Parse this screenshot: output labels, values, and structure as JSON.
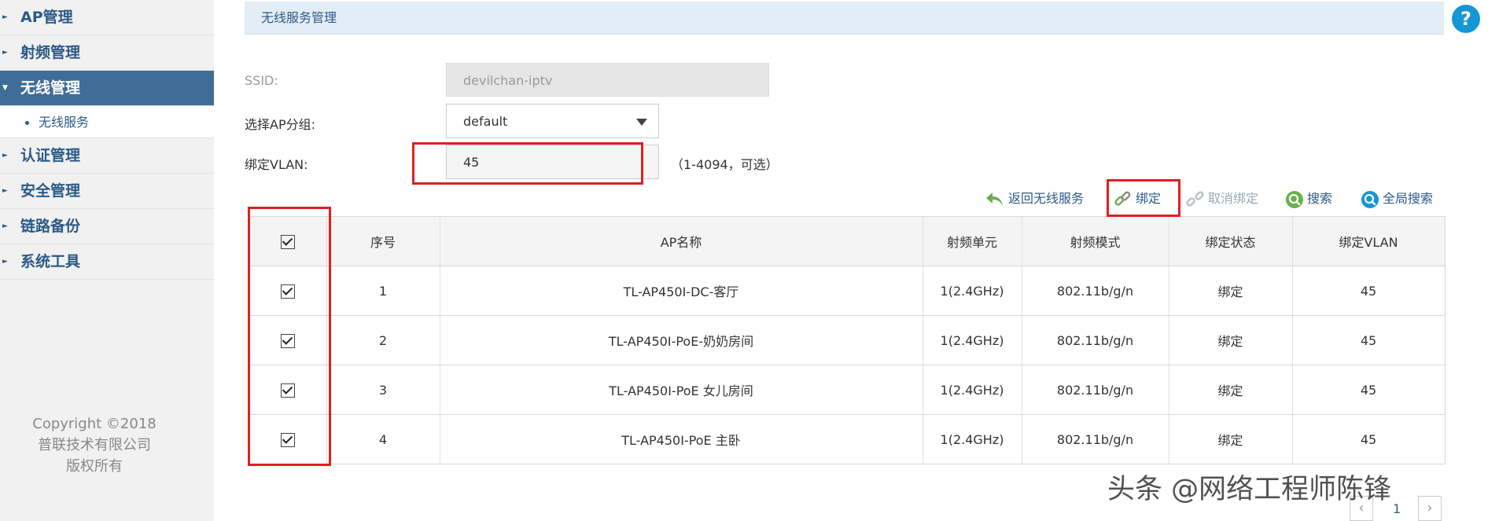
{
  "sidebar": {
    "items": [
      {
        "label": "AP管理"
      },
      {
        "label": "射频管理"
      },
      {
        "label": "无线管理",
        "sub": "无线服务"
      },
      {
        "label": "认证管理"
      },
      {
        "label": "安全管理"
      },
      {
        "label": "链路备份"
      },
      {
        "label": "系统工具"
      }
    ],
    "copyright": [
      "Copyright ©2018",
      "普联技术有限公司",
      "版权所有"
    ]
  },
  "header": {
    "title": "无线服务管理",
    "help": "?"
  },
  "form": {
    "ssid_label": "SSID:",
    "ssid_value": "devilchan-iptv",
    "group_label": "选择AP分组:",
    "group_value": "default",
    "vlan_label": "绑定VLAN:",
    "vlan_value": "45",
    "vlan_hint": "（1-4094，可选）"
  },
  "toolbar": {
    "back": "返回无线服务",
    "bind": "绑定",
    "unbind": "取消绑定",
    "search": "搜索",
    "global_search": "全局搜索"
  },
  "table": {
    "headers": [
      "序号",
      "AP名称",
      "射频单元",
      "射频模式",
      "绑定状态",
      "绑定VLAN"
    ],
    "rows": [
      {
        "no": "1",
        "name": "TL-AP450I-DC-客厅",
        "radio": "1(2.4GHz)",
        "mode": "802.11b/g/n",
        "status": "绑定",
        "vlan": "45"
      },
      {
        "no": "2",
        "name": "TL-AP450I-PoE-奶奶房间",
        "radio": "1(2.4GHz)",
        "mode": "802.11b/g/n",
        "status": "绑定",
        "vlan": "45"
      },
      {
        "no": "3",
        "name": "TL-AP450I-PoE 女儿房间",
        "radio": "1(2.4GHz)",
        "mode": "802.11b/g/n",
        "status": "绑定",
        "vlan": "45"
      },
      {
        "no": "4",
        "name": "TL-AP450I-PoE 主卧",
        "radio": "1(2.4GHz)",
        "mode": "802.11b/g/n",
        "status": "绑定",
        "vlan": "45"
      }
    ]
  },
  "pagination": {
    "current": "1",
    "prev": "‹",
    "next": "›"
  },
  "watermark": "头条 @网络工程师陈锋",
  "colors": {
    "accent": "#2c5a86",
    "active_nav": "#3f6d98",
    "highlight": "#e02020",
    "help": "#1596d6"
  },
  "icons": {
    "back": "undo-arrow-icon",
    "bind": "chain-link-icon",
    "unbind": "broken-link-icon",
    "search": "magnifier-icon",
    "global_search": "global-magnifier-icon"
  }
}
